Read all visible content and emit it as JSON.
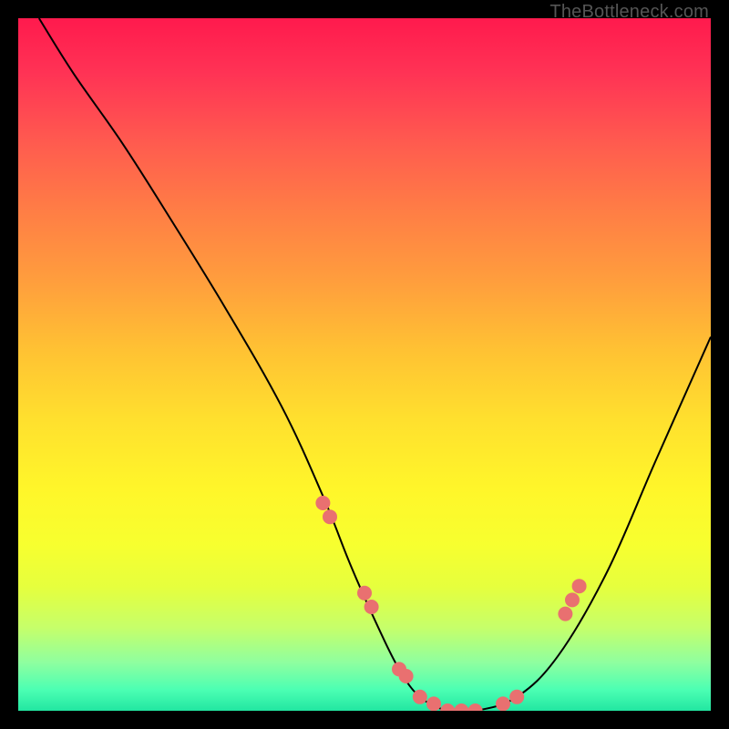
{
  "watermark": "TheBottleneck.com",
  "chart_data": {
    "type": "line",
    "title": "",
    "xlabel": "",
    "ylabel": "",
    "xlim": [
      0,
      100
    ],
    "ylim": [
      0,
      100
    ],
    "series": [
      {
        "name": "bottleneck-curve",
        "x": [
          3,
          8,
          15,
          22,
          30,
          38,
          44,
          48,
          52,
          55,
          58,
          62,
          66,
          72,
          78,
          85,
          92,
          100
        ],
        "y": [
          100,
          92,
          82,
          71,
          58,
          44,
          31,
          21,
          12,
          6,
          2,
          0,
          0,
          2,
          8,
          20,
          36,
          54
        ]
      }
    ],
    "markers": {
      "name": "data-points",
      "color": "#e97070",
      "x": [
        44,
        45,
        50,
        51,
        55,
        56,
        58,
        60,
        62,
        64,
        66,
        70,
        72,
        79,
        80,
        81
      ],
      "y": [
        30,
        28,
        17,
        15,
        6,
        5,
        2,
        1,
        0,
        0,
        0,
        1,
        2,
        14,
        16,
        18
      ]
    }
  }
}
